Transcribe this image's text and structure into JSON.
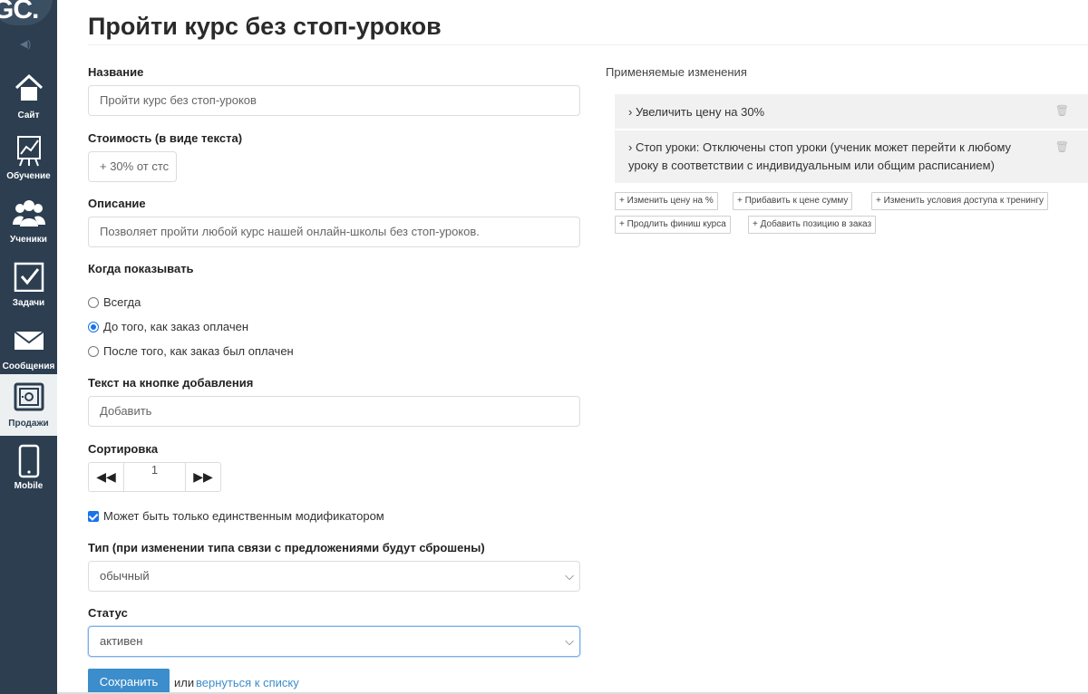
{
  "sidebar": {
    "logo": "GC.",
    "items": [
      {
        "label": "Сайт",
        "icon": "home-icon"
      },
      {
        "label": "Обучение",
        "icon": "chart-board-icon"
      },
      {
        "label": "Ученики",
        "icon": "users-icon"
      },
      {
        "label": "Задачи",
        "icon": "checkbox-icon"
      },
      {
        "label": "Сообщения",
        "icon": "envelope-icon"
      },
      {
        "label": "Продажи",
        "icon": "safe-icon"
      },
      {
        "label": "Mobile",
        "icon": "mobile-icon"
      }
    ]
  },
  "page": {
    "title": "Пройти курс без стоп-уроков"
  },
  "form": {
    "name_label": "Название",
    "name_value": "Пройти курс без стоп-уроков",
    "price_label": "Стоимость (в виде текста)",
    "price_value": "+ 30% от стс",
    "desc_label": "Описание",
    "desc_value": "Позволяет пройти любой курс нашей онлайн-школы без стоп-уроков.",
    "show_label": "Когда показывать",
    "show_options": [
      {
        "label": "Всегда",
        "selected": false
      },
      {
        "label": "До того, как заказ оплачен",
        "selected": true
      },
      {
        "label": "После того, как заказ был оплачен",
        "selected": false
      }
    ],
    "button_text_label": "Текст на кнопке добавления",
    "button_text_value": "Добавить",
    "sort_label": "Сортировка",
    "sort_value": "1",
    "only_modifier_label": "Может быть только единственным модификатором",
    "only_modifier_checked": true,
    "type_label": "Тип (при изменении типа связи с предложениями будут сброшены)",
    "type_value": "обычный",
    "status_label": "Статус",
    "status_value": "активен",
    "save_label": "Сохранить",
    "or_text": "или",
    "back_link": "вернуться к списку"
  },
  "changes": {
    "title": "Применяемые изменения",
    "items": [
      {
        "text": "› Увеличить цену на 30%"
      },
      {
        "text": "› Стоп уроки: Отключены стоп уроки (ученик может перейти к любому уроку в соответствии с индивидуальным или общим расписанием)"
      }
    ],
    "actions": [
      "+ Изменить цену на %",
      "+ Прибавить к цене сумму",
      "+ Изменить условия доступа к тренингу",
      "+ Продлить финиш курса",
      "+ Добавить позицию в заказ"
    ]
  },
  "colors": {
    "sidebar_bg": "#2c3e50",
    "accent": "#3c8dcb",
    "checkbox": "#1a73e8"
  }
}
